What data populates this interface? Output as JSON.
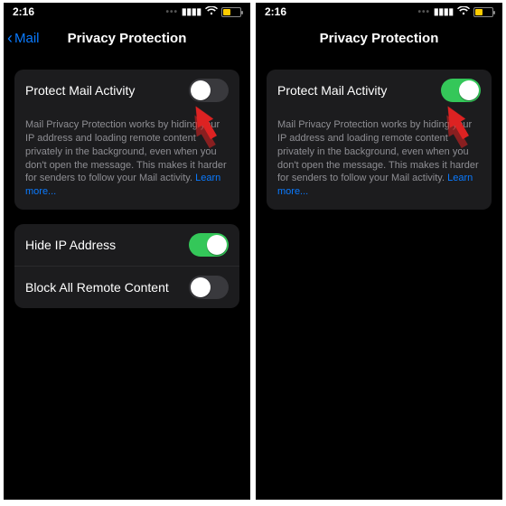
{
  "status": {
    "time": "2:16"
  },
  "nav": {
    "back_label": "Mail",
    "title": "Privacy Protection"
  },
  "rows": {
    "protect": "Protect Mail Activity",
    "hide_ip": "Hide IP Address",
    "block_remote": "Block All Remote Content"
  },
  "footer": {
    "text": "Mail Privacy Protection works by hiding your IP address and loading remote content privately in the background, even when you don't open the message. This makes it harder for senders to follow your Mail activity. ",
    "link": "Learn more..."
  },
  "left": {
    "protect_on": false,
    "hide_ip_on": true,
    "block_remote_on": false
  },
  "right": {
    "protect_on": true
  }
}
